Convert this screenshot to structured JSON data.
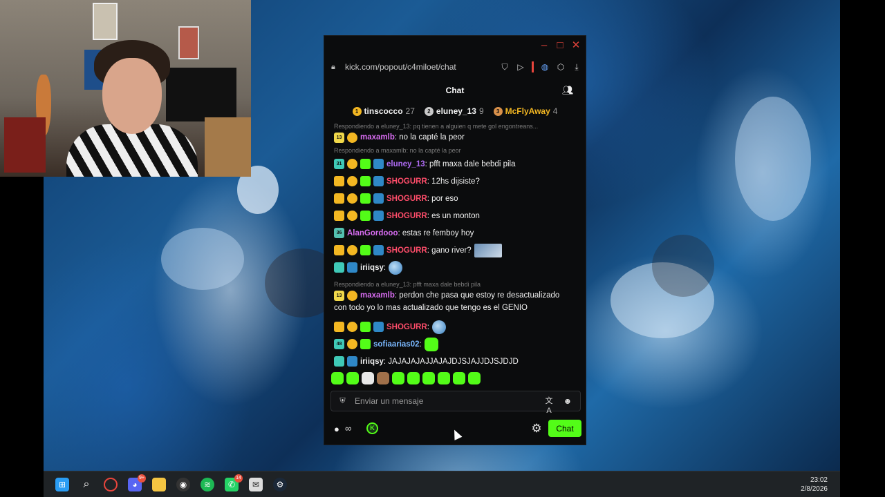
{
  "browser": {
    "url": "kick.com/popout/c4miloet/chat"
  },
  "chat": {
    "title": "Chat",
    "leaderboard": [
      {
        "rank": "1",
        "name": "tinscocco",
        "count": "27",
        "color": "#f3b722"
      },
      {
        "rank": "2",
        "name": "eluney_13",
        "count": "9",
        "color": "#c9c9c9"
      },
      {
        "rank": "3",
        "name": "McFlyAway",
        "count": "4",
        "color": "#d9914b"
      }
    ],
    "replies": {
      "r1": "Respondiendo a eluney_13: pq tienen a alguien q mete gol engontreans...",
      "r2": "Respondiendo a maxamlb: no la capté la peor",
      "r3": "Respondiendo a eluney_13: pfft maxa dale bebdi pila"
    },
    "messages": {
      "m1": {
        "user": "maxamlb",
        "text": ": no la capté la peor",
        "badge": "13"
      },
      "m2": {
        "user": "eluney_13",
        "text": ": pfft maxa dale bebdi pila",
        "badge": "31"
      },
      "m3": {
        "user": "SHOGURR",
        "text": ": 12hs dijsiste?"
      },
      "m4": {
        "user": "SHOGURR",
        "text": ": por eso"
      },
      "m5": {
        "user": "SHOGURR",
        "text": ": es un monton"
      },
      "m6": {
        "user": "AlanGordooo",
        "text": ": estas re femboy hoy",
        "badge": "36"
      },
      "m7": {
        "user": "SHOGURR",
        "text": ": gano river?"
      },
      "m8": {
        "user": "iriiqsy",
        "text": ":"
      },
      "m9": {
        "user": "maxamlb",
        "text": ": perdon che pasa que estoy re desactualizado",
        "cont": "con todo yo lo mas actualizado que tengo es el GENIO",
        "badge": "13"
      },
      "m10": {
        "user": "SHOGURR",
        "text": ":"
      },
      "m11": {
        "user": "sofiaarias02",
        "text": ":",
        "badge": "48"
      },
      "m12": {
        "user": "iriiqsy",
        "text": ": JAJAJAJAJJAJAJDJSJAJJDJSJDJD"
      }
    },
    "input_placeholder": "Enviar un mensaje",
    "send_button": "Chat",
    "points_value": "∞"
  },
  "taskbar": {
    "time": "23:02",
    "date": "2/8/2026",
    "discord_badge": "9+",
    "whatsapp_badge": "14"
  },
  "colors": {
    "kick_green": "#53fc18",
    "username_pink": "#d96df2",
    "username_red": "#ff4d6a",
    "username_purple": "#b06cf5",
    "username_blue": "#7ab8ff"
  }
}
